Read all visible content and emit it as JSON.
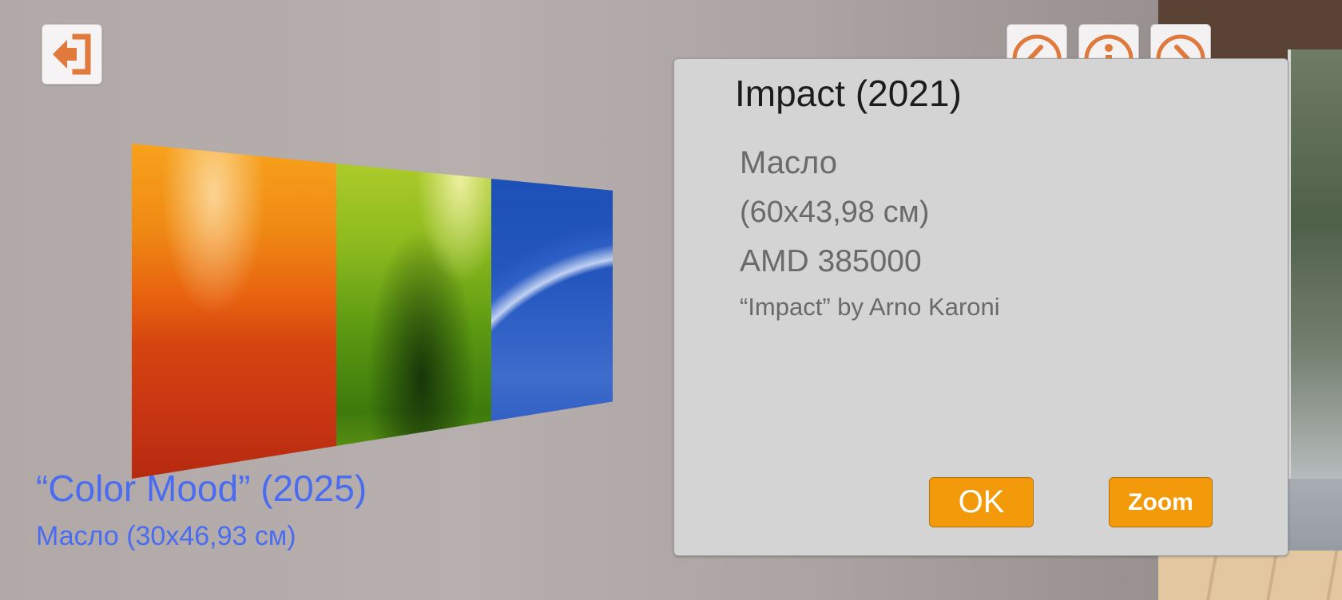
{
  "colors": {
    "accent_orange": "#f29a0a",
    "icon_orange": "#e07a3c",
    "caption_blue": "#4a6cf0",
    "dialog_bg": "#d4d4d4"
  },
  "toolbar": {
    "exit_icon": "exit-icon",
    "prev_icon": "chevron-left-icon",
    "info_icon": "info-icon",
    "next_icon": "chevron-right-icon"
  },
  "dialog": {
    "title": "Impact (2021)",
    "medium": "Масло",
    "size": "(60x43,98 см)",
    "price": "AMD 385000",
    "caption": "“Impact” by Arno Karoni",
    "ok_label": "OK",
    "zoom_label": "Zoom"
  },
  "artwork": {
    "title": "“Color Mood” (2025)",
    "details": "Масло (30x46,93 см)"
  }
}
